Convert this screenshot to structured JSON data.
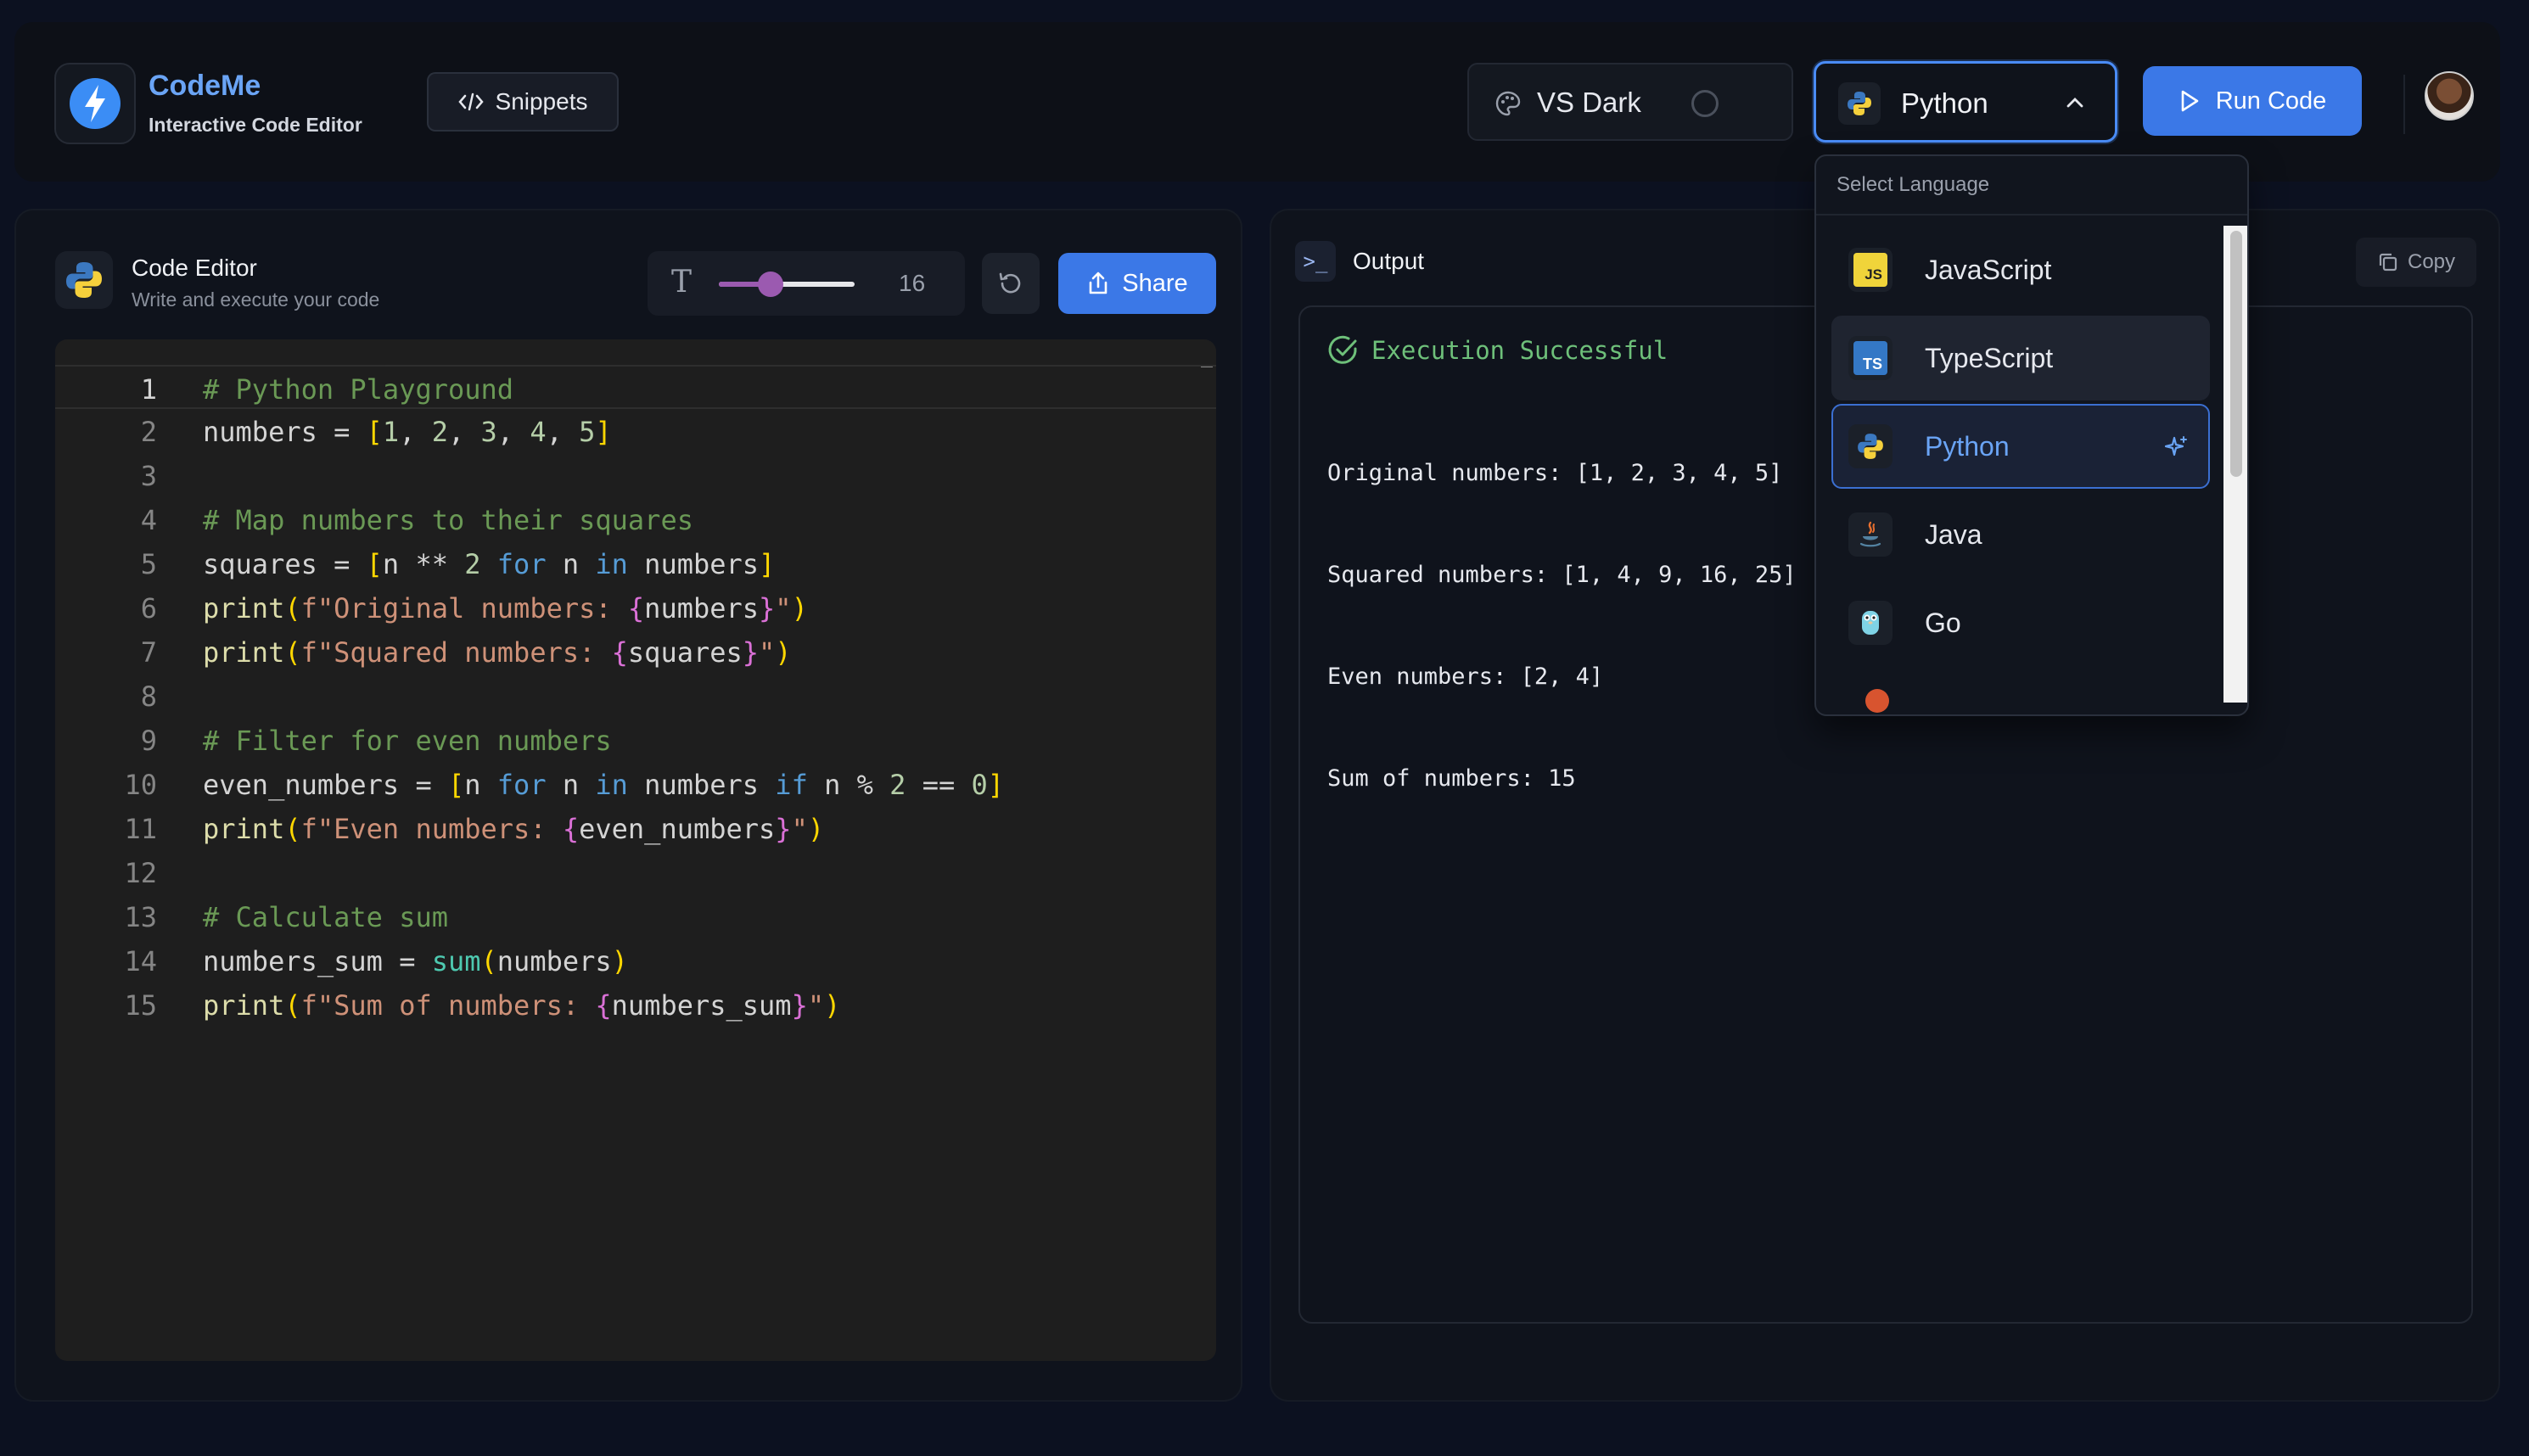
{
  "app": {
    "name": "CodeMe",
    "subtitle": "Interactive Code Editor"
  },
  "header": {
    "snippets_label": "Snippets",
    "theme_label": "VS Dark",
    "language_label": "Python",
    "run_label": "Run Code"
  },
  "editor": {
    "title": "Code Editor",
    "subtitle": "Write and execute your code",
    "font_size": "16",
    "font_size_slider_fraction": 0.38,
    "share_label": "Share",
    "lines": [
      {
        "n": "1",
        "parts": [
          [
            "com",
            "# Python Playground"
          ]
        ]
      },
      {
        "n": "2",
        "parts": [
          [
            "",
            "numbers = "
          ],
          [
            "br1",
            "["
          ],
          [
            "num",
            "1"
          ],
          [
            "",
            ", "
          ],
          [
            "num",
            "2"
          ],
          [
            "",
            ", "
          ],
          [
            "num",
            "3"
          ],
          [
            "",
            ", "
          ],
          [
            "num",
            "4"
          ],
          [
            "",
            ", "
          ],
          [
            "num",
            "5"
          ],
          [
            "br1",
            "]"
          ]
        ]
      },
      {
        "n": "3",
        "parts": []
      },
      {
        "n": "4",
        "parts": [
          [
            "com",
            "# Map numbers to their squares"
          ]
        ]
      },
      {
        "n": "5",
        "parts": [
          [
            "",
            "squares = "
          ],
          [
            "br1",
            "["
          ],
          [
            "",
            "n ** "
          ],
          [
            "num",
            "2"
          ],
          [
            "",
            " "
          ],
          [
            "kw",
            "for"
          ],
          [
            "",
            " n "
          ],
          [
            "kw",
            "in"
          ],
          [
            "",
            " numbers"
          ],
          [
            "br1",
            "]"
          ]
        ]
      },
      {
        "n": "6",
        "parts": [
          [
            "fn",
            "print"
          ],
          [
            "br1",
            "("
          ],
          [
            "str",
            "f\"Original numbers: "
          ],
          [
            "br2",
            "{"
          ],
          [
            "",
            "numbers"
          ],
          [
            "br2",
            "}"
          ],
          [
            "str",
            "\""
          ],
          [
            "br1",
            ")"
          ]
        ]
      },
      {
        "n": "7",
        "parts": [
          [
            "fn",
            "print"
          ],
          [
            "br1",
            "("
          ],
          [
            "str",
            "f\"Squared numbers: "
          ],
          [
            "br2",
            "{"
          ],
          [
            "",
            "squares"
          ],
          [
            "br2",
            "}"
          ],
          [
            "str",
            "\""
          ],
          [
            "br1",
            ")"
          ]
        ]
      },
      {
        "n": "8",
        "parts": []
      },
      {
        "n": "9",
        "parts": [
          [
            "com",
            "# Filter for even numbers"
          ]
        ]
      },
      {
        "n": "10",
        "parts": [
          [
            "",
            "even_numbers = "
          ],
          [
            "br1",
            "["
          ],
          [
            "",
            "n "
          ],
          [
            "kw",
            "for"
          ],
          [
            "",
            " n "
          ],
          [
            "kw",
            "in"
          ],
          [
            "",
            " numbers "
          ],
          [
            "kw",
            "if"
          ],
          [
            "",
            " n % "
          ],
          [
            "num",
            "2"
          ],
          [
            "",
            " == "
          ],
          [
            "num",
            "0"
          ],
          [
            "br1",
            "]"
          ]
        ]
      },
      {
        "n": "11",
        "parts": [
          [
            "fn",
            "print"
          ],
          [
            "br1",
            "("
          ],
          [
            "str",
            "f\"Even numbers: "
          ],
          [
            "br2",
            "{"
          ],
          [
            "",
            "even_numbers"
          ],
          [
            "br2",
            "}"
          ],
          [
            "str",
            "\""
          ],
          [
            "br1",
            ")"
          ]
        ]
      },
      {
        "n": "12",
        "parts": []
      },
      {
        "n": "13",
        "parts": [
          [
            "com",
            "# Calculate sum"
          ]
        ]
      },
      {
        "n": "14",
        "parts": [
          [
            "",
            "numbers_sum = "
          ],
          [
            "blt",
            "sum"
          ],
          [
            "br1",
            "("
          ],
          [
            "",
            "numbers"
          ],
          [
            "br1",
            ")"
          ]
        ]
      },
      {
        "n": "15",
        "parts": [
          [
            "fn",
            "print"
          ],
          [
            "br1",
            "("
          ],
          [
            "str",
            "f\"Sum of numbers: "
          ],
          [
            "br2",
            "{"
          ],
          [
            "",
            "numbers_sum"
          ],
          [
            "br2",
            "}"
          ],
          [
            "str",
            "\""
          ],
          [
            "br1",
            ")"
          ]
        ]
      }
    ]
  },
  "output": {
    "title": "Output",
    "copy_label": "Copy",
    "status": "Execution Successful",
    "lines": [
      "Original numbers: [1, 2, 3, 4, 5]",
      "Squared numbers: [1, 4, 9, 16, 25]",
      "Even numbers: [2, 4]",
      "Sum of numbers: 15"
    ]
  },
  "dropdown": {
    "heading": "Select Language",
    "items": [
      {
        "label": "JavaScript",
        "icon": "javascript-icon",
        "state": ""
      },
      {
        "label": "TypeScript",
        "icon": "typescript-icon",
        "state": "hover"
      },
      {
        "label": "Python",
        "icon": "python-icon",
        "state": "selected"
      },
      {
        "label": "Java",
        "icon": "java-icon",
        "state": ""
      },
      {
        "label": "Go",
        "icon": "go-icon",
        "state": ""
      }
    ]
  },
  "colors": {
    "accent": "#3b78e7",
    "success": "#6ec07a",
    "slider": "#9b5ab0"
  }
}
